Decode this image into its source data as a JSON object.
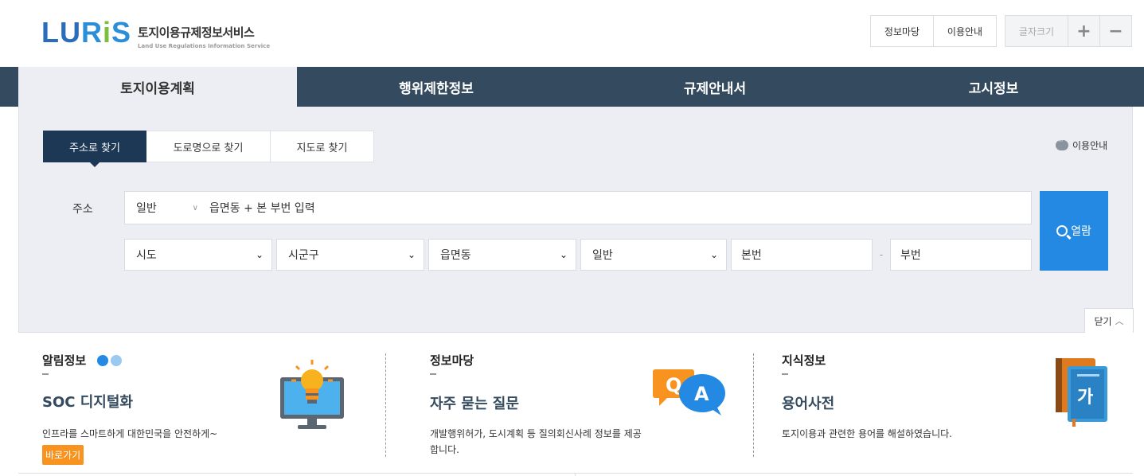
{
  "logo": {
    "mark": "LURIS",
    "ko": "토지이용규제정보서비스",
    "en": "Land Use Regulations Information Service"
  },
  "top_buttons": [
    {
      "label": "정보마당"
    },
    {
      "label": "이용안내"
    }
  ],
  "font_size": {
    "label": "글자크기",
    "plus": "+",
    "minus": "−"
  },
  "nav_tabs": [
    {
      "label": "토지이용계획",
      "active": true
    },
    {
      "label": "행위제한정보",
      "active": false
    },
    {
      "label": "규제안내서",
      "active": false
    },
    {
      "label": "고시정보",
      "active": false
    }
  ],
  "search": {
    "subtabs": [
      {
        "label": "주소로 찾기",
        "active": true
      },
      {
        "label": "도로명으로 찾기",
        "active": false
      },
      {
        "label": "지도로 찾기",
        "active": false
      }
    ],
    "guide_label": "이용안내",
    "address_label": "주소",
    "address_type": "일반",
    "address_placeholder": "읍면동 + 본 부번 입력",
    "selects": [
      {
        "value": "시도"
      },
      {
        "value": "시군구"
      },
      {
        "value": "읍면동"
      },
      {
        "value": "일반"
      }
    ],
    "bonbeon": "본번",
    "bubeon": "부번",
    "separator": "-",
    "view_button": "열람",
    "close_button": "닫기"
  },
  "info": [
    {
      "title": "알림정보",
      "head": "SOC 디지털화",
      "desc": "인프라를 스마트하게 대한민국을 안전하게~",
      "button": "바로가기"
    },
    {
      "title": "정보마당",
      "head": "자주 묻는 질문",
      "desc": "개발행위허가, 도시계획 등 질의회신사례 정보를 제공합니다."
    },
    {
      "title": "지식정보",
      "head": "용어사전",
      "desc": "토지이용과 관련한 용어를 해설하였습니다."
    }
  ],
  "icons": {
    "qa_q": "Q",
    "qa_a": "A",
    "dict": "가"
  },
  "colors": {
    "nav_bg": "#344a5f",
    "active_subtab": "#1d3855",
    "view_button": "#2489e2",
    "go_button": "#f7931e"
  }
}
